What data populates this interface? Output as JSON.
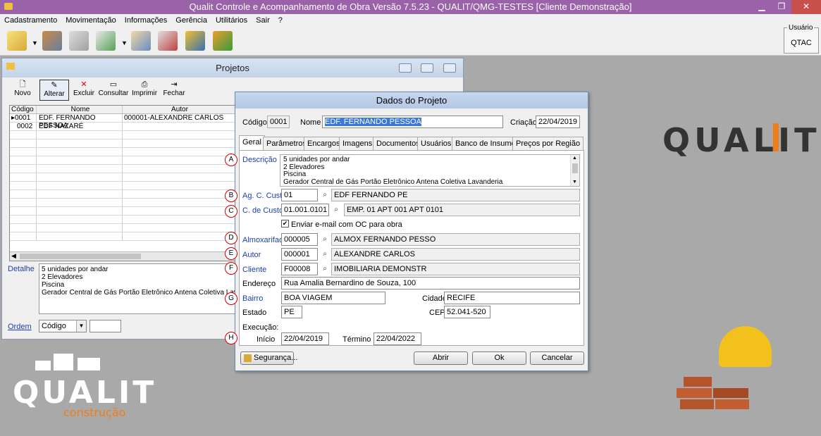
{
  "app": {
    "title": "Qualit Controle e Acompanhamento de Obra Versão 7.5.23 - QUALIT/QMG-TESTES [Cliente Demonstração]",
    "menu": [
      "Cadastramento",
      "Movimentação",
      "Informações",
      "Gerência",
      "Utilitários",
      "Sair",
      "?"
    ],
    "usuario_label": "Usuário",
    "usuario_value": "QTAC",
    "brand_logo": "QUALIT",
    "construcao_logo": "construção"
  },
  "projetos": {
    "title": "Projetos",
    "toolbar": [
      "Novo",
      "Alterar",
      "Excluir",
      "Consultar",
      "Imprimir",
      "Fechar"
    ],
    "columns": [
      "Código",
      "Nome",
      "Autor"
    ],
    "rows": [
      {
        "codigo": "0001",
        "nome": "EDF. FERNANDO PESSOA",
        "autor": "000001-ALEXANDRE CARLOS"
      },
      {
        "codigo": "0002",
        "nome": "EDF NAZARÉ",
        "autor": ""
      }
    ],
    "detalhe_label": "Detalhe",
    "detalhe_lines": [
      "5 unidades por andar",
      "2 Elevadores",
      "Piscina",
      "Gerador Central de Gás Portão Eletrônico Antena Coletiva Lavand"
    ],
    "ordem_label": "Ordem",
    "ordem_value": "Código"
  },
  "dados": {
    "title": "Dados do Projeto",
    "codigo_label": "Código",
    "codigo_value": "0001",
    "nome_label": "Nome",
    "nome_value": "EDF. FERNANDO PESSOA",
    "criacao_label": "Criação",
    "criacao_value": "22/04/2019",
    "tabs": [
      "Geral",
      "Parâmetros",
      "Encargos",
      "Imagens",
      "Documentos",
      "Usuários",
      "Banco de Insumos",
      "Preços por Região"
    ],
    "descricao_label": "Descrição",
    "descricao_lines": [
      "5 unidades por andar",
      "2 Elevadores",
      "Piscina",
      "Gerador Central de Gás Portão Eletrônico Antena Coletiva Lavanderia"
    ],
    "ag_label": "Ag. C. Custos",
    "ag_code": "01",
    "ag_desc": "EDF FERNANDO PE",
    "cc_label": "C. de Custos",
    "cc_code": "01.001.0101",
    "cc_desc": "EMP. 01 APT 001 APT 0101",
    "email_label": "Enviar e-mail com OC para obra",
    "almox_label": "Almoxarifado",
    "almox_code": "000005",
    "almox_desc": "ALMOX FERNANDO PESSO",
    "autor_label": "Autor",
    "autor_code": "000001",
    "autor_desc": "ALEXANDRE CARLOS",
    "cliente_label": "Cliente",
    "cliente_code": "F00008",
    "cliente_desc": "IMOBILIARIA DEMONSTR",
    "endereco_label": "Endereço",
    "endereco_value": "Rua Amalia Bernardino de Souza, 100",
    "bairro_label": "Bairro",
    "bairro_value": "BOA VIAGEM",
    "cidade_label": "Cidade",
    "cidade_value": "RECIFE",
    "estado_label": "Estado",
    "estado_value": "PE",
    "cep_label": "CEP",
    "cep_value": "52.041-520",
    "execucao_label": "Execução:",
    "inicio_label": "Início",
    "inicio_value": "22/04/2019",
    "termino_label": "Término",
    "termino_value": "22/04/2022",
    "seguranca_label": "Segurança...",
    "abrir_label": "Abrir",
    "ok_label": "Ok",
    "cancelar_label": "Cancelar",
    "markers": [
      "A",
      "B",
      "C",
      "D",
      "E",
      "F",
      "G",
      "H"
    ]
  }
}
